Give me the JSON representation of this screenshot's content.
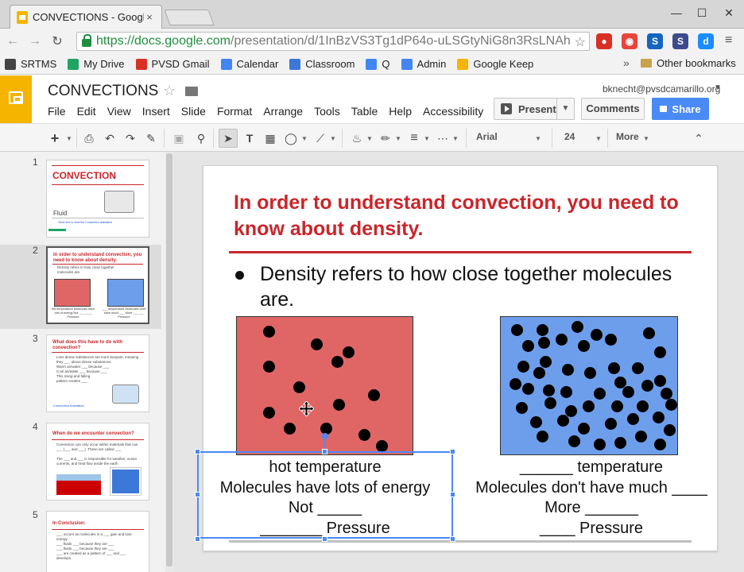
{
  "browser": {
    "tab_title": "CONVECTIONS - Google",
    "tab_close": "×",
    "url_scheme": "https://",
    "url_host": "docs.google.com",
    "url_path": "/presentation/d/1InBzVS3Tg1dP64o-uLSGtyNiG8n3RsLNAh",
    "window_controls": [
      "—",
      "☐",
      "✕"
    ],
    "extensions": [
      {
        "name": "adblock-icon",
        "color": "#d93025",
        "glyph": "●"
      },
      {
        "name": "record-icon",
        "color": "#e8453c",
        "glyph": "◉"
      },
      {
        "name": "screencastify-icon",
        "color": "#1565c0",
        "glyph": "S"
      },
      {
        "name": "s-extension-icon",
        "color": "#3c4b8c",
        "glyph": "S"
      },
      {
        "name": "d-extension-icon",
        "color": "#1a8cff",
        "glyph": "d"
      }
    ]
  },
  "bookmarks": {
    "items": [
      {
        "label": "SRTMS",
        "color": "#444"
      },
      {
        "label": "My Drive",
        "color": "#1fa463"
      },
      {
        "label": "PVSD Gmail",
        "color": "#d93025"
      },
      {
        "label": "Calendar",
        "color": "#4285f4"
      },
      {
        "label": "Classroom",
        "color": "#3c78d8"
      },
      {
        "label": "Q",
        "color": "#4285f4"
      },
      {
        "label": "Admin",
        "color": "#4285f4"
      },
      {
        "label": "Google Keep",
        "color": "#f4b400"
      }
    ],
    "overflow": "»",
    "other": "Other bookmarks"
  },
  "app": {
    "doc_title": "CONVECTIONS",
    "user_email": "bknecht@pvsdcamarillo.org",
    "menus": [
      "File",
      "Edit",
      "View",
      "Insert",
      "Slide",
      "Format",
      "Arrange",
      "Tools",
      "Table",
      "Help",
      "Accessibility"
    ],
    "present_label": "Present",
    "comments_label": "Comments",
    "share_label": "Share",
    "accent": "#f4b400",
    "share_color": "#4a8af4"
  },
  "toolbar": {
    "font_name": "Arial",
    "font_size": "24",
    "more_label": "More"
  },
  "filmstrip": {
    "slides": [
      {
        "num": "1",
        "title": "CONVECTION",
        "sub": "Fluid",
        "foot": "Click here to view the Convection animation"
      },
      {
        "num": "2",
        "title": "In order to understand convection, you need to know about density.",
        "lines": [
          "Density refers to how close together",
          "molecules are."
        ],
        "cap_left": "hot temperature Molecules have lots of energy Not ___ ____ Pressure",
        "cap_right": "___ temperature Molecules don't have much ___ More ___ ___ Pressure"
      },
      {
        "num": "3",
        "title": "What does this have to do with convection?",
        "lines": [
          "Less dense substances are more buoyant, meaning they ___ above dense substances.",
          "Warm air/water ___ because ___",
          "Cool air/water ___ because ___",
          "This rising and falling pattern creates ___"
        ],
        "foot": "Convection Animation"
      },
      {
        "num": "4",
        "title": "When do we encounter convection?",
        "lines": [
          "Convection can only occur within materials that can ___ (___ and ___). These are called ___",
          "The ___ and ___ is responsible for weather, ocean currents, and heat flow inside the earth"
        ]
      },
      {
        "num": "5",
        "title": "In Conclusion:",
        "lines": [
          "___ occurs as molecules in a ___ gain and lose energy.",
          "___ fluids ___ because they are ___",
          "___ fluids ___ because they are ___",
          "___ are created as a pattern of ___ and ___ develops."
        ]
      }
    ]
  },
  "slide": {
    "title": "In order to understand convection, you need to know about density.",
    "bullet": "Density refers to how close together molecules are.",
    "left_caption": [
      "hot temperature",
      "Molecules have lots of energy",
      "Not _____",
      "_______ Pressure"
    ],
    "right_caption": [
      "______ temperature",
      "Molecules don't have much ____",
      "More ______",
      "____ Pressure"
    ],
    "hot_color": "#e06666",
    "cold_color": "#6d9eeb",
    "title_color": "#c9262b"
  }
}
